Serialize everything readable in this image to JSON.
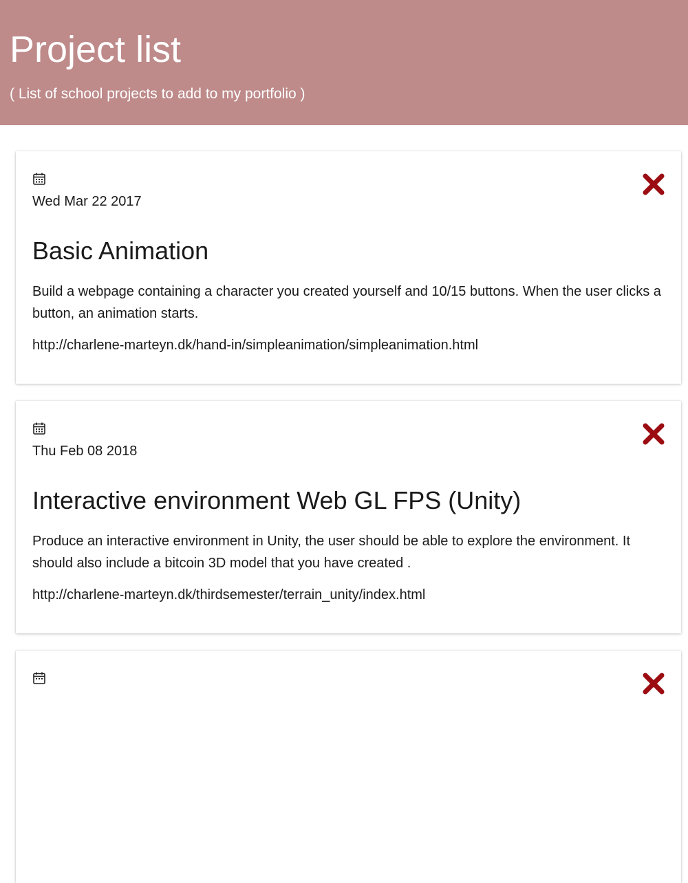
{
  "header": {
    "title": "Project list",
    "subtitle": "( List of school projects to add to my portfolio )"
  },
  "colors": {
    "header_bg": "#be8a8a",
    "delete_icon": "#9b0d12"
  },
  "projects": [
    {
      "date": "Wed Mar 22 2017",
      "title": "Basic Animation",
      "description": "Build a webpage containing a character you created yourself and 10/15 buttons. When the user clicks a button, an animation starts.",
      "url": "http://charlene-marteyn.dk/hand-in/simpleanimation/simpleanimation.html",
      "icon": "calendar-icon",
      "delete_icon": "close-icon"
    },
    {
      "date": "Thu Feb 08 2018",
      "title": "Interactive environment Web GL FPS (Unity)",
      "description": "Produce an interactive environment in Unity, the user should be able to explore the environment. It should also include a bitcoin 3D model that you have created .",
      "url": "http://charlene-marteyn.dk/thirdsemester/terrain_unity/index.html",
      "icon": "calendar-icon",
      "delete_icon": "close-icon"
    },
    {
      "date": "",
      "title": "",
      "description": "",
      "url": "",
      "icon": "calendar-icon",
      "delete_icon": "close-icon"
    }
  ]
}
